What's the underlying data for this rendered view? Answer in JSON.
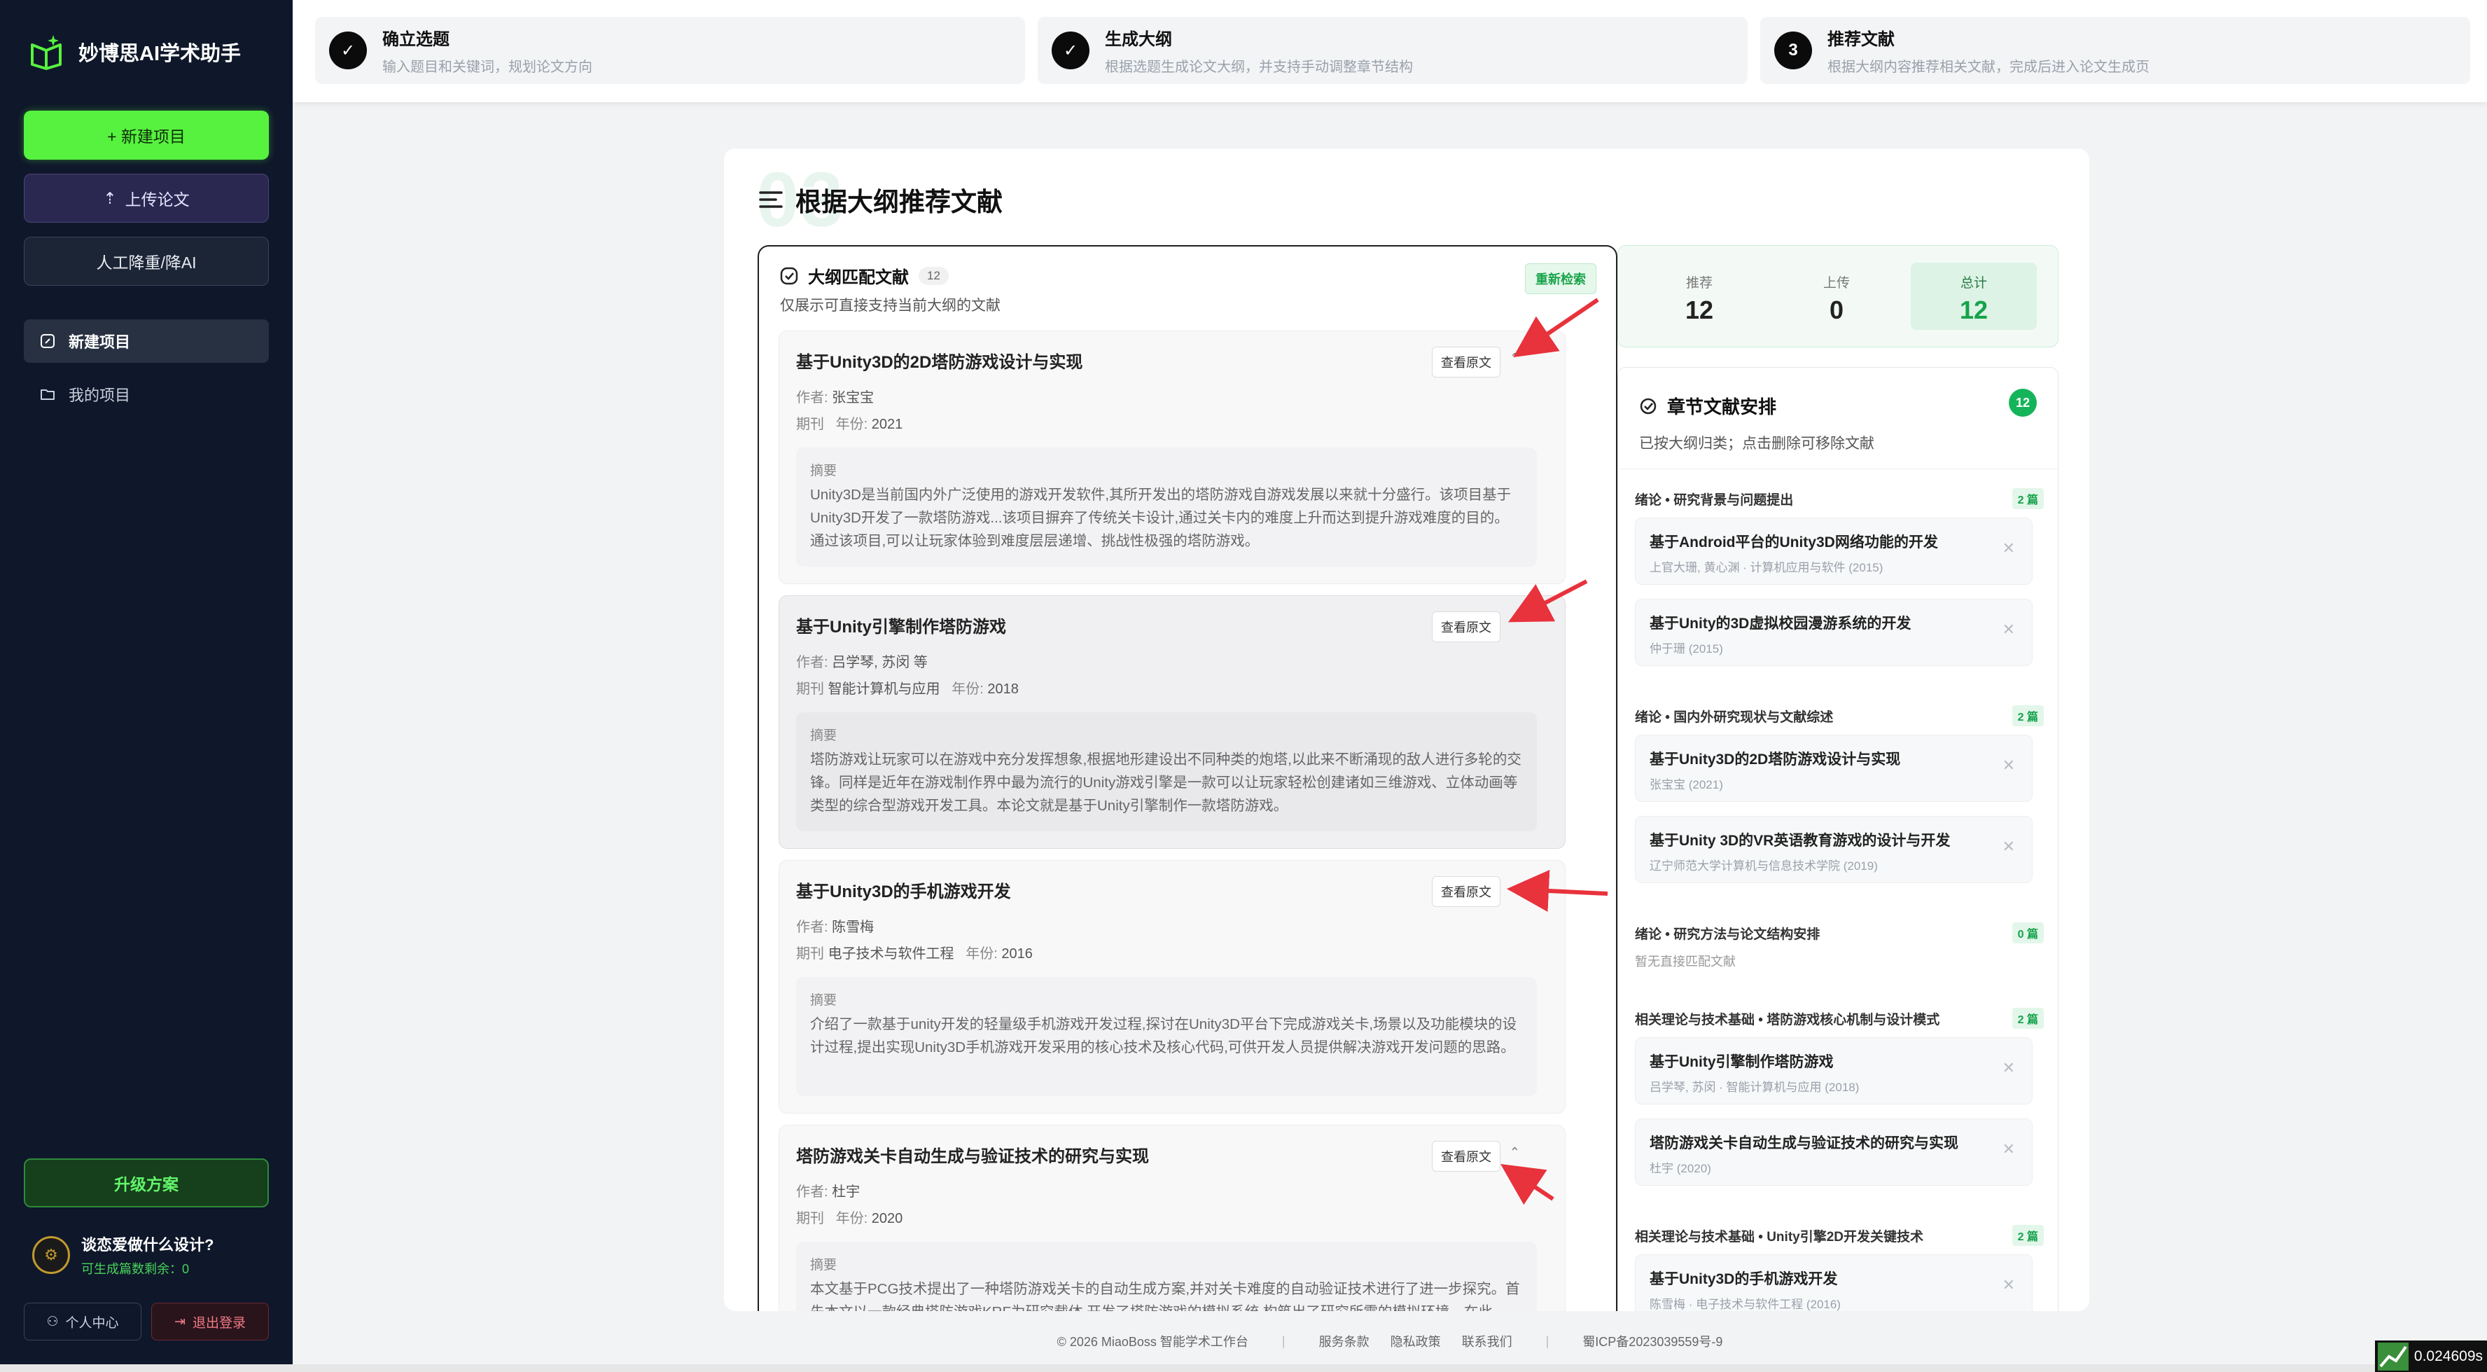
{
  "app": {
    "name": "妙博思AI学术助手",
    "new_project_button": "+ 新建项目",
    "upload_button": "上传论文",
    "ai_button": "人工降重/降AI",
    "nav": [
      {
        "label": "新建项目"
      },
      {
        "label": "我的项目"
      }
    ],
    "upgrade_button": "升级方案",
    "user": {
      "name": "谈恋爱做什么设计?",
      "quota": "可生成篇数剩余：0",
      "avatar_text": "⚙"
    },
    "profile_button": "个人中心",
    "logout_button": "退出登录"
  },
  "steps": [
    {
      "index": "✓",
      "title": "确立选题",
      "subtitle": "输入题目和关键词，规划论文方向"
    },
    {
      "index": "✓",
      "title": "生成大纲",
      "subtitle": "根据选题生成论文大纲，并支持手动调整章节结构"
    },
    {
      "index": "3",
      "title": "推荐文献",
      "subtitle": "根据大纲内容推荐相关文献，完成后进入论文生成页"
    }
  ],
  "main": {
    "bg_number": "03",
    "title": "根据大纲推荐文献",
    "left": {
      "title": "大纲匹配文献",
      "count": "12",
      "subtitle": "仅展示可直接支持当前大纲的文献",
      "research_button": "重新检索",
      "view_button": "查看原文",
      "author_label": "作者:",
      "journal_label": "期刊",
      "year_label": "年份:",
      "abstract_label": "摘要",
      "papers": [
        {
          "title": "基于Unity3D的2D塔防游戏设计与实现",
          "author": "张宝宝",
          "journal": "",
          "year": "2021",
          "abstract": "Unity3D是当前国内外广泛使用的游戏开发软件,其所开发出的塔防游戏自游戏发展以来就十分盛行。该项目基于Unity3D开发了一款塔防游戏...该项目摒弃了传统关卡设计,通过关卡内的难度上升而达到提升游戏难度的目的。通过该项目,可以让玩家体验到难度层层递增、挑战性极强的塔防游戏。"
        },
        {
          "title": "基于Unity引擎制作塔防游戏",
          "author": "吕学琴, 苏闵 等",
          "journal": "智能计算机与应用",
          "year": "2018",
          "abstract": "塔防游戏让玩家可以在游戏中充分发挥想象,根据地形建设出不同种类的炮塔,以此来不断涌现的敌人进行多轮的交锋。同样是近年在游戏制作界中最为流行的Unity游戏引擎是一款可以让玩家轻松创建诸如三维游戏、立体动画等类型的综合型游戏开发工具。本论文就是基于Unity引擎制作一款塔防游戏。"
        },
        {
          "title": "基于Unity3D的手机游戏开发",
          "author": "陈雪梅",
          "journal": "电子技术与软件工程",
          "year": "2016",
          "abstract": "介绍了一款基于unity开发的轻量级手机游戏开发过程,探讨在Unity3D平台下完成游戏关卡,场景以及功能模块的设计过程,提出实现Unity3D手机游戏开发采用的核心技术及核心代码,可供开发人员提供解决游戏开发问题的思路。"
        },
        {
          "title": "塔防游戏关卡自动生成与验证技术的研究与实现",
          "author": "杜宇",
          "journal": "",
          "year": "2020",
          "abstract": "本文基于PCG技术提出了一种塔防游戏关卡的自动生成方案,并对关卡难度的自动验证技术进行了进一步探究。首先本文以一款经典塔防游戏KRF为研究载体,开发了塔防游戏的模拟系统,构筑出了研究所需的模拟环境。在此"
        }
      ]
    },
    "stats": [
      {
        "label": "推荐",
        "value": "12"
      },
      {
        "label": "上传",
        "value": "0"
      },
      {
        "label": "总计",
        "value": "12"
      }
    ],
    "chapters": {
      "title": "章节文献安排",
      "badge": "12",
      "subtitle": "已按大纲归类；点击删除可移除文献",
      "sections": [
        {
          "name": "绪论 • 研究背景与问题提出",
          "count": "2 篇",
          "items": [
            {
              "title": "基于Android平台的Unity3D网络功能的开发",
              "meta": "上官大珊, 黄心渊 · 计算机应用与软件 (2015)"
            },
            {
              "title": "基于Unity的3D虚拟校园漫游系统的开发",
              "meta": "仲于珊 (2015)"
            }
          ]
        },
        {
          "name": "绪论 • 国内外研究现状与文献综述",
          "count": "2 篇",
          "items": [
            {
              "title": "基于Unity3D的2D塔防游戏设计与实现",
              "meta": "张宝宝 (2021)"
            },
            {
              "title": "基于Unity 3D的VR英语教育游戏的设计与开发",
              "meta": "辽宁师范大学计算机与信息技术学院 (2019)"
            }
          ]
        },
        {
          "name": "绪论 • 研究方法与论文结构安排",
          "count": "0 篇",
          "empty": "暂无直接匹配文献",
          "items": []
        },
        {
          "name": "相关理论与技术基础 • 塔防游戏核心机制与设计模式",
          "count": "2 篇",
          "items": [
            {
              "title": "基于Unity引擎制作塔防游戏",
              "meta": "吕学琴, 苏闵 · 智能计算机与应用 (2018)"
            },
            {
              "title": "塔防游戏关卡自动生成与验证技术的研究与实现",
              "meta": "杜宇 (2020)"
            }
          ]
        },
        {
          "name": "相关理论与技术基础 • Unity引擎2D开发关键技术",
          "count": "2 篇",
          "items": [
            {
              "title": "基于Unity3D的手机游戏开发",
              "meta": "陈雪梅 · 电子技术与软件工程 (2016)"
            }
          ]
        }
      ]
    }
  },
  "footer": {
    "copyright": "© 2026 MiaoBoss 智能学术工作台",
    "links": [
      "服务条款",
      "隐私政策",
      "联系我们"
    ],
    "icp": "蜀ICP备2023039559号-9"
  },
  "speed": "0.024609s",
  "colors": {
    "sidebar_bg": "#0f172a",
    "accent_green": "#57f23f",
    "arrow_red": "#e8323c",
    "success": "#16a34a"
  }
}
